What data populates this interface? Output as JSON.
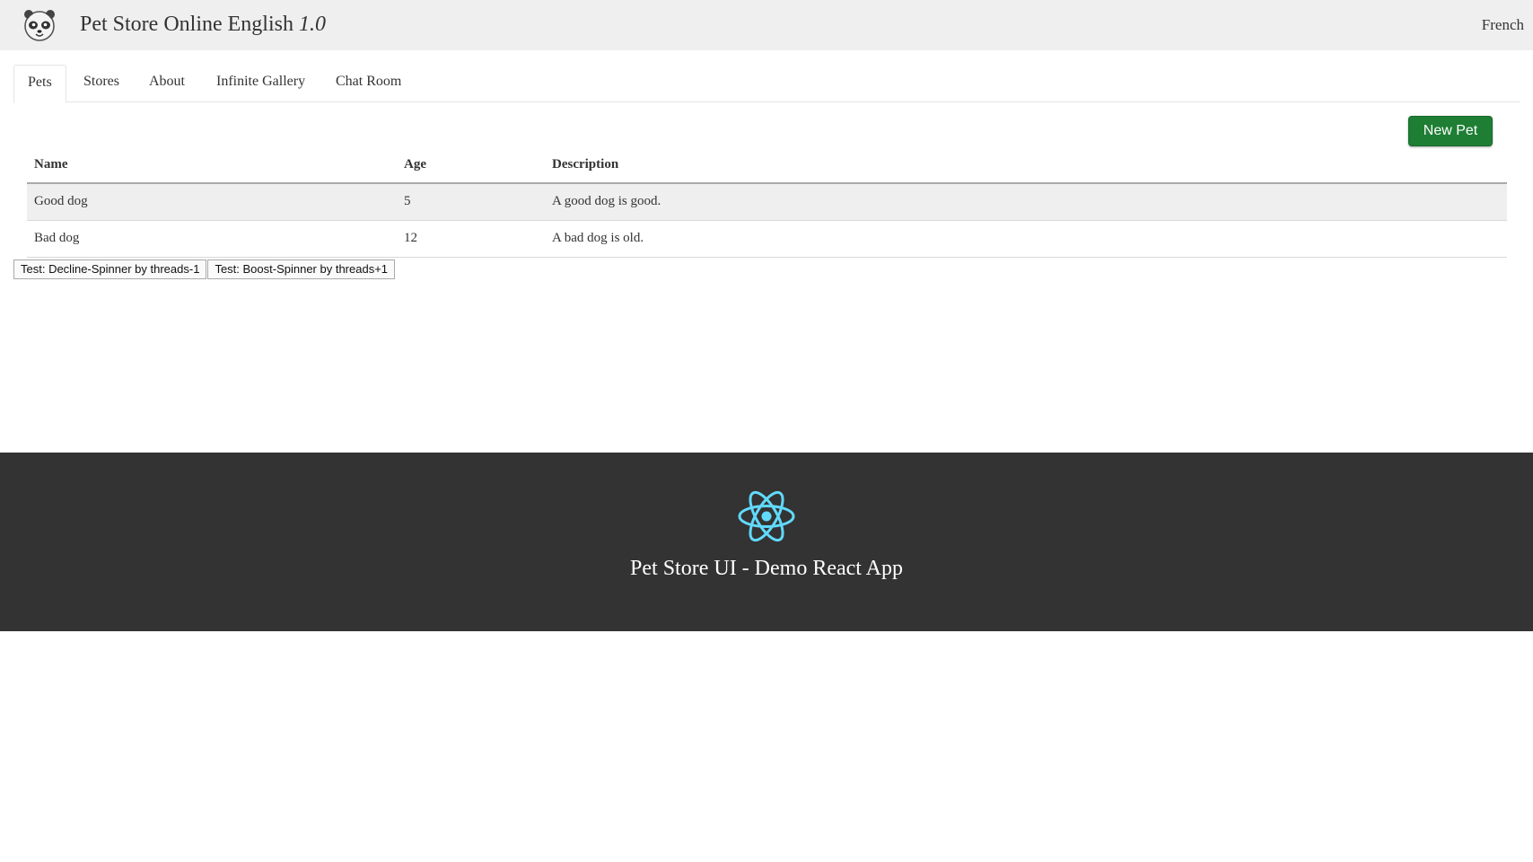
{
  "header": {
    "title": "Pet Store Online English",
    "version": "1.0",
    "language_link": "French",
    "logo_icon": "panda-logo-icon"
  },
  "tabs": [
    {
      "label": "Pets",
      "active": true
    },
    {
      "label": "Stores",
      "active": false
    },
    {
      "label": "About",
      "active": false
    },
    {
      "label": "Infinite Gallery",
      "active": false
    },
    {
      "label": "Chat Room",
      "active": false
    }
  ],
  "actions": {
    "new_pet_label": "New Pet",
    "new_pet_color": "#1e7e34"
  },
  "table": {
    "columns": [
      "Name",
      "Age",
      "Description"
    ],
    "rows": [
      [
        "Good dog",
        "5",
        "A good dog is good."
      ],
      [
        "Bad dog",
        "12",
        "A bad dog is old."
      ]
    ]
  },
  "test_buttons": [
    "Test: Decline-Spinner by threads-1",
    "Test: Boost-Spinner by threads+1"
  ],
  "footer": {
    "title": "Pet Store UI - Demo React App",
    "logo_icon": "react-logo-icon",
    "background": "#333333",
    "logo_color": "#61dafb"
  }
}
